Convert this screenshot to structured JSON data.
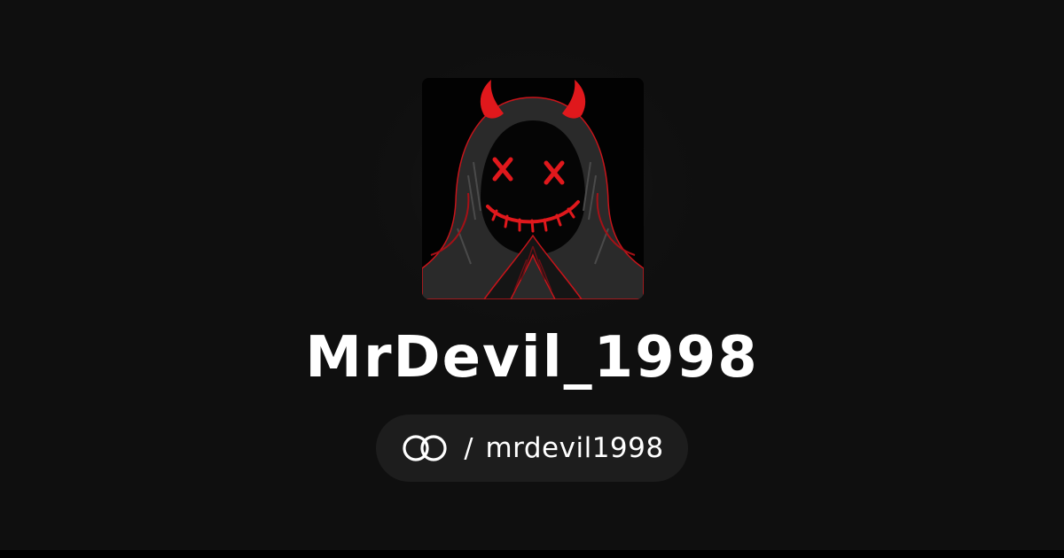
{
  "profile": {
    "display_name": "MrDevil_1998",
    "handle": "mrdevil1998",
    "separator": "/",
    "avatar_icon": "hooded-devil-avatar-icon",
    "platform_logo_icon": "interlinked-rings-logo-icon"
  },
  "colors": {
    "background": "#0f0f0f",
    "pill_background": "#1d1d1d",
    "accent_red": "#e0181c",
    "text": "#ffffff"
  }
}
